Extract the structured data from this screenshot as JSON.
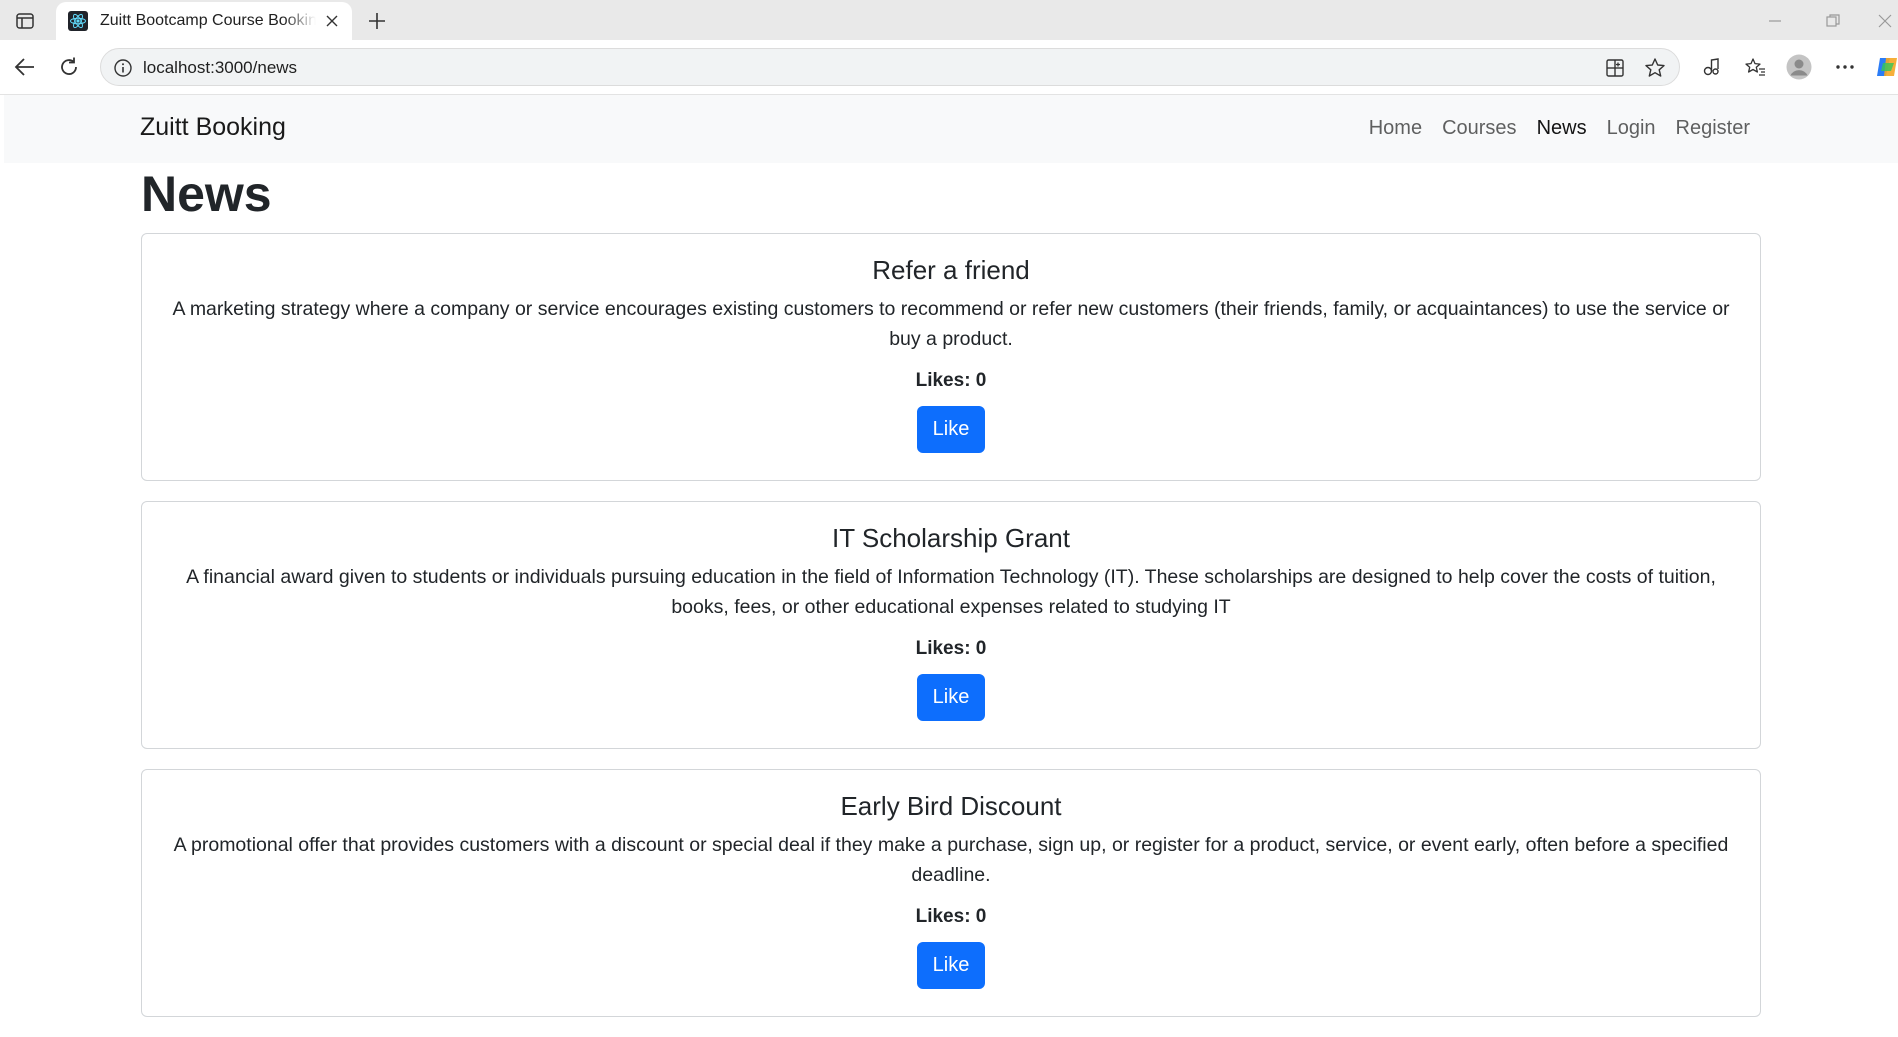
{
  "browser": {
    "tab": {
      "title": "Zuitt Bootcamp Course Booking System"
    },
    "address": {
      "url": "localhost:3000/news"
    },
    "icons": {
      "sidebar": "tab-sidebar-icon",
      "close": "close-icon",
      "new_tab": "plus-icon",
      "back": "back-arrow-icon",
      "reload": "reload-icon",
      "info": "info-icon",
      "apps": "app-install-icon",
      "favorite": "star-icon",
      "extensions": "extensions-icon",
      "favorites_list": "favorites-list-icon",
      "profile": "profile-avatar",
      "more": "more-icon",
      "copilot": "copilot-icon"
    }
  },
  "navbar": {
    "brand": "Zuitt Booking",
    "links": [
      {
        "label": "Home",
        "active": false
      },
      {
        "label": "Courses",
        "active": false
      },
      {
        "label": "News",
        "active": true
      },
      {
        "label": "Login",
        "active": false
      },
      {
        "label": "Register",
        "active": false
      }
    ]
  },
  "page": {
    "title": "News",
    "cards": [
      {
        "title": "Refer a friend",
        "text": "A marketing strategy where a company or service encourages existing customers to recommend or refer new customers (their friends, family, or acquaintances) to use the service or buy a product.",
        "likes": "Likes: 0",
        "button": "Like"
      },
      {
        "title": "IT Scholarship Grant",
        "text": "A financial award given to students or individuals pursuing education in the field of Information Technology (IT). These scholarships are designed to help cover the costs of tuition, books, fees, or other educational expenses related to studying IT",
        "likes": "Likes: 0",
        "button": "Like"
      },
      {
        "title": "Early Bird Discount",
        "text": "A promotional offer that provides customers with a discount or special deal if they make a purchase, sign up, or register for a product, service, or event early, often before a specified deadline.",
        "likes": "Likes: 0",
        "button": "Like"
      }
    ]
  },
  "colors": {
    "primary": "#0d6efd",
    "navbar_bg": "#f8f9fa",
    "border": "#d3d6d9"
  }
}
